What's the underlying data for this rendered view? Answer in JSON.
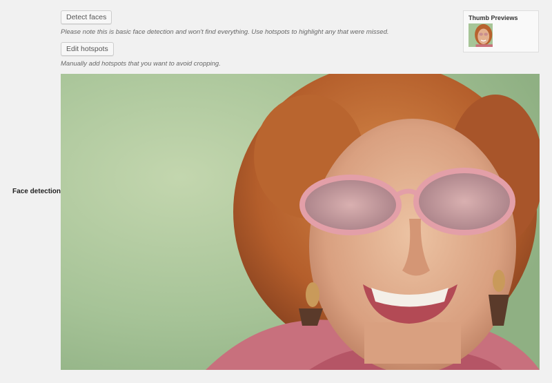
{
  "buttons": {
    "detect_faces": "Detect faces",
    "edit_hotspots": "Edit hotspots"
  },
  "notes": {
    "detect": "Please note this is basic face detection and won't find everything. Use hotspots to highlight any that were missed.",
    "hotspots": "Manually add hotspots that you want to avoid cropping."
  },
  "row_label": "Face detection",
  "thumb_previews": {
    "title": "Thumb Previews"
  },
  "colors": {
    "page_bg": "#f1f1f1",
    "photo_bg": "#a9c49a",
    "hair": "#b8622e",
    "skin": "#e2b08f",
    "glasses": "#d89aa3"
  }
}
